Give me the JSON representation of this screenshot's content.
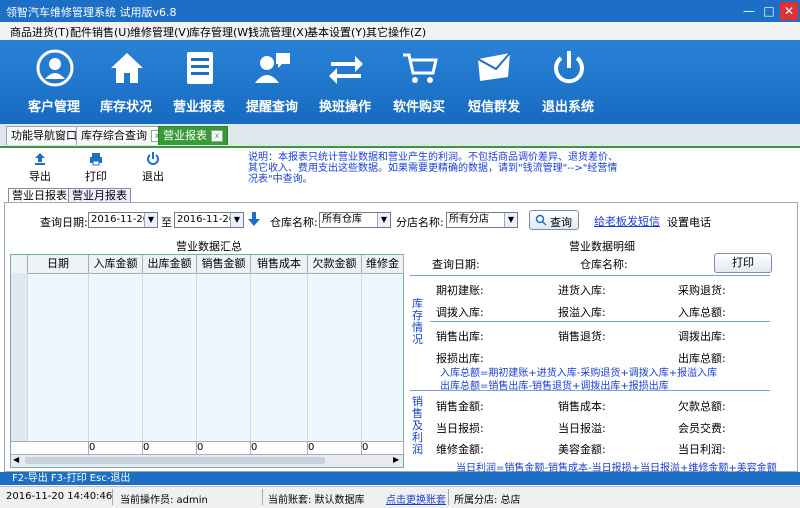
{
  "window": {
    "title": "领智汽车维修管理系统 试用版v6.8",
    "min": "—",
    "max": "□",
    "close": "✕"
  },
  "menu": [
    "商品进货(T)",
    "配件销售(U)",
    "维修管理(V)",
    "库存管理(W)",
    "钱流管理(X)",
    "基本设置(Y)",
    "其它操作(Z)"
  ],
  "toolbar": [
    {
      "label": "客户管理",
      "icon": "user-icon"
    },
    {
      "label": "库存状况",
      "icon": "home-icon"
    },
    {
      "label": "营业报表",
      "icon": "list-icon"
    },
    {
      "label": "提醒查询",
      "icon": "chat-user-icon"
    },
    {
      "label": "换班操作",
      "icon": "swap-icon"
    },
    {
      "label": "软件购买",
      "icon": "cart-icon"
    },
    {
      "label": "短信群发",
      "icon": "mail-icon"
    },
    {
      "label": "退出系统",
      "icon": "power-icon"
    }
  ],
  "tabs": [
    "功能导航窗口",
    "库存综合查询",
    "营业报表"
  ],
  "actions": {
    "export": "导出",
    "print": "打印",
    "exit": "退出"
  },
  "note": "说明：本报表只统计营业数据和营业产生的利润。不包括商品调价差异、退货差价、其它收入、费用支出这些数据。如果需要更精确的数据，请到\"钱流管理\"-->\"经营情况表\"中查询。",
  "subtabs": [
    "营业日报表",
    "营业月报表"
  ],
  "query": {
    "date_label": "查询日期:",
    "date_from": "2016-11-20",
    "to": "至",
    "date_to": "2016-11-20",
    "warehouse_label": "仓库名称:",
    "warehouse": "所有仓库",
    "branch_label": "分店名称:",
    "branch": "所有分店",
    "query_btn": "查询",
    "sms_link": "给老板发短信",
    "phone": "设置电话"
  },
  "summary": {
    "title": "营业数据汇总",
    "columns": [
      "日期",
      "入库金额",
      "出库金额",
      "销售金额",
      "销售成本",
      "欠款金额",
      "维修金额"
    ],
    "totals": [
      "0",
      "0",
      "0",
      "0",
      "0",
      "0"
    ]
  },
  "detail": {
    "title": "营业数据明细",
    "query_date": "查询日期:",
    "warehouse": "仓库名称:",
    "print": "打印",
    "stock_section": "库存情况",
    "stock_rows": [
      [
        "期初建账:",
        "进货入库:",
        "采购退货:"
      ],
      [
        "调拨入库:",
        "报溢入库:",
        "入库总额:"
      ],
      [
        "销售出库:",
        "销售退货:",
        "调拨出库:"
      ],
      [
        "报损出库:",
        "",
        "出库总额:"
      ]
    ],
    "in_formula": "入库总额=期初建账+进货入库-采购退货+调拨入库+报溢入库",
    "out_formula": "出库总额=销售出库-销售退货+调拨出库+报损出库",
    "profit_section": "销售及利润",
    "profit_rows": [
      [
        "销售金额:",
        "销售成本:",
        "欠款总额:"
      ],
      [
        "当日报损:",
        "当日报溢:",
        "会员交费:"
      ],
      [
        "维修金额:",
        "美容金额:",
        "当日利润:"
      ]
    ],
    "profit_formula": "当日利润=销售金额-销售成本-当日报损+当日报溢+维修金额+美容金额"
  },
  "hotkeys": "F2-导出  F3-打印  Esc-退出",
  "status": {
    "datetime": "2016-11-20 14:40:46",
    "operator": "当前操作员: admin",
    "account": "当前账套: 默认数据库",
    "change_account": "点击更换账套",
    "branch": "所属分店: 总店"
  },
  "colors": {
    "accent": "#1c6fc4",
    "tab_active": "#3a9a3a",
    "note": "#1a3fd0"
  }
}
